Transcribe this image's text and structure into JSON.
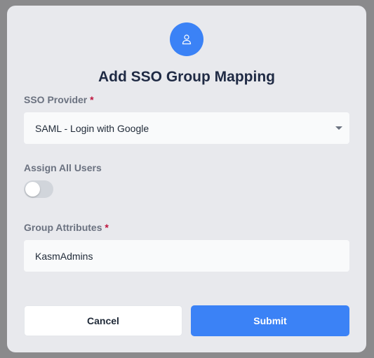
{
  "dialog": {
    "title": "Add SSO Group Mapping",
    "icon": "user-icon",
    "accent_color": "#3b82f6"
  },
  "sso_provider": {
    "label": "SSO Provider",
    "required_marker": "*",
    "selected_value": "SAML - Login with Google"
  },
  "assign_all_users": {
    "label": "Assign All Users",
    "enabled": false
  },
  "group_attributes": {
    "label": "Group Attributes",
    "required_marker": "*",
    "value": "KasmAdmins"
  },
  "actions": {
    "cancel_label": "Cancel",
    "submit_label": "Submit"
  }
}
